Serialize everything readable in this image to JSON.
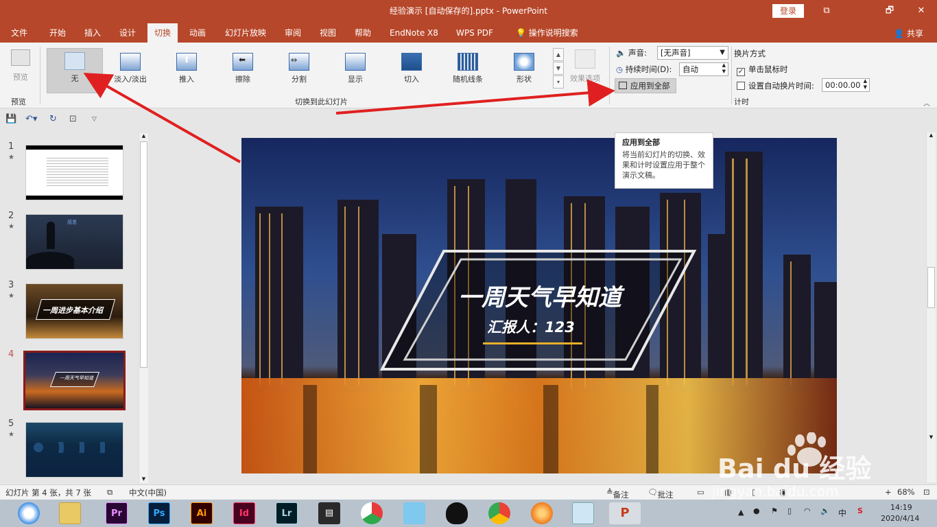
{
  "window": {
    "title": "经验演示 [自动保存的].pptx  -  PowerPoint",
    "login": "登录",
    "controls": [
      "⧉",
      "🗗",
      "✕"
    ]
  },
  "menu": {
    "tabs": [
      "文件",
      "开始",
      "插入",
      "设计",
      "切换",
      "动画",
      "幻灯片放映",
      "审阅",
      "视图",
      "帮助",
      "EndNote X8",
      "WPS PDF"
    ],
    "active_tab": "切换",
    "tell_me": "操作说明搜索",
    "share": "共享"
  },
  "ribbon": {
    "preview": {
      "label": "预览",
      "group": "预览"
    },
    "transitions": [
      {
        "label": "无",
        "selected": true
      },
      {
        "label": "淡入/淡出"
      },
      {
        "label": "推入"
      },
      {
        "label": "擦除"
      },
      {
        "label": "分割"
      },
      {
        "label": "显示"
      },
      {
        "label": "切入"
      },
      {
        "label": "随机线条"
      },
      {
        "label": "形状"
      }
    ],
    "effect_options": "效果选项",
    "transition_group": "切换到此幻灯片",
    "timing": {
      "sound_label": "声音:",
      "sound_value": "[无声音]",
      "duration_label": "持续时间(D):",
      "duration_value": "自动",
      "apply_all": "应用到全部",
      "advance_title": "换片方式",
      "on_click": "单击鼠标时",
      "on_click_checked": true,
      "auto_after": "设置自动换片时间:",
      "auto_after_checked": false,
      "auto_time": "00:00.00",
      "group": "计时"
    }
  },
  "tooltip": {
    "title": "应用到全部",
    "body": "将当前幻灯片的切换、效果和计时设置应用于整个演示文稿。"
  },
  "thumbnails": [
    {
      "num": "1",
      "star": "★"
    },
    {
      "num": "2",
      "star": "★",
      "text": "感恩"
    },
    {
      "num": "3",
      "star": "★",
      "text": "一周进步基本介绍"
    },
    {
      "num": "4",
      "star": "",
      "text": "一周天气早知道",
      "active": true
    },
    {
      "num": "5",
      "star": "★"
    }
  ],
  "slide": {
    "title": "一周天气早知道",
    "subtitle": "汇报人：123"
  },
  "statusbar": {
    "slide_info": "幻灯片 第 4 张，共 7 张",
    "language": "中文(中国)",
    "notes": "备注",
    "comments": "批注",
    "zoom": "68%"
  },
  "taskbar": {
    "time": "14:19",
    "date": "2020/4/14",
    "ime": "中"
  },
  "watermark": {
    "brand": "Bai du 经验",
    "url": "jingyan.baidu.com"
  },
  "colors": {
    "brand": "#b7472a",
    "arrow": "#e02020"
  }
}
